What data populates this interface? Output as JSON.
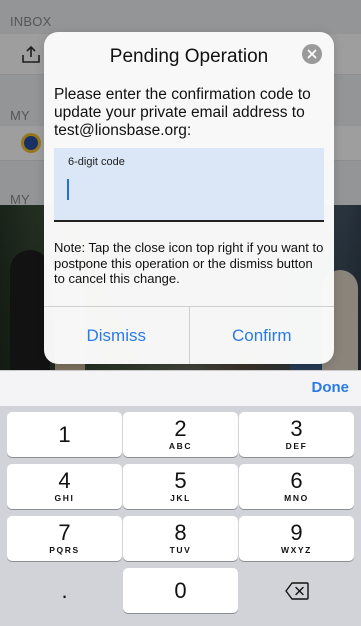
{
  "background": {
    "inbox_label": "INBOX",
    "section2_label": "MY",
    "section3_label": "MY"
  },
  "alert": {
    "title": "Pending Operation",
    "message": "Please enter the confirmation code to update your private email address to test@lionsbase.org:",
    "code_field": {
      "label": "6-digit code",
      "value": ""
    },
    "note": "Note: Tap the close icon top right if you want to postpone this operation or the dismiss button to cancel this change.",
    "buttons": {
      "dismiss": "Dismiss",
      "confirm": "Confirm"
    }
  },
  "keyboard": {
    "done_label": "Done",
    "keys": [
      {
        "num": "1",
        "letters": ""
      },
      {
        "num": "2",
        "letters": "ABC"
      },
      {
        "num": "3",
        "letters": "DEF"
      },
      {
        "num": "4",
        "letters": "GHI"
      },
      {
        "num": "5",
        "letters": "JKL"
      },
      {
        "num": "6",
        "letters": "MNO"
      },
      {
        "num": "7",
        "letters": "PQRS"
      },
      {
        "num": "8",
        "letters": "TUV"
      },
      {
        "num": "9",
        "letters": "WXYZ"
      },
      {
        "num": ".",
        "letters": ""
      },
      {
        "num": "0",
        "letters": ""
      },
      {
        "num": "delete-icon",
        "letters": ""
      }
    ]
  },
  "colors": {
    "accent": "#2a7be6",
    "field_bg": "#dbe7f7",
    "keypad_bg": "#d1d3d9"
  }
}
